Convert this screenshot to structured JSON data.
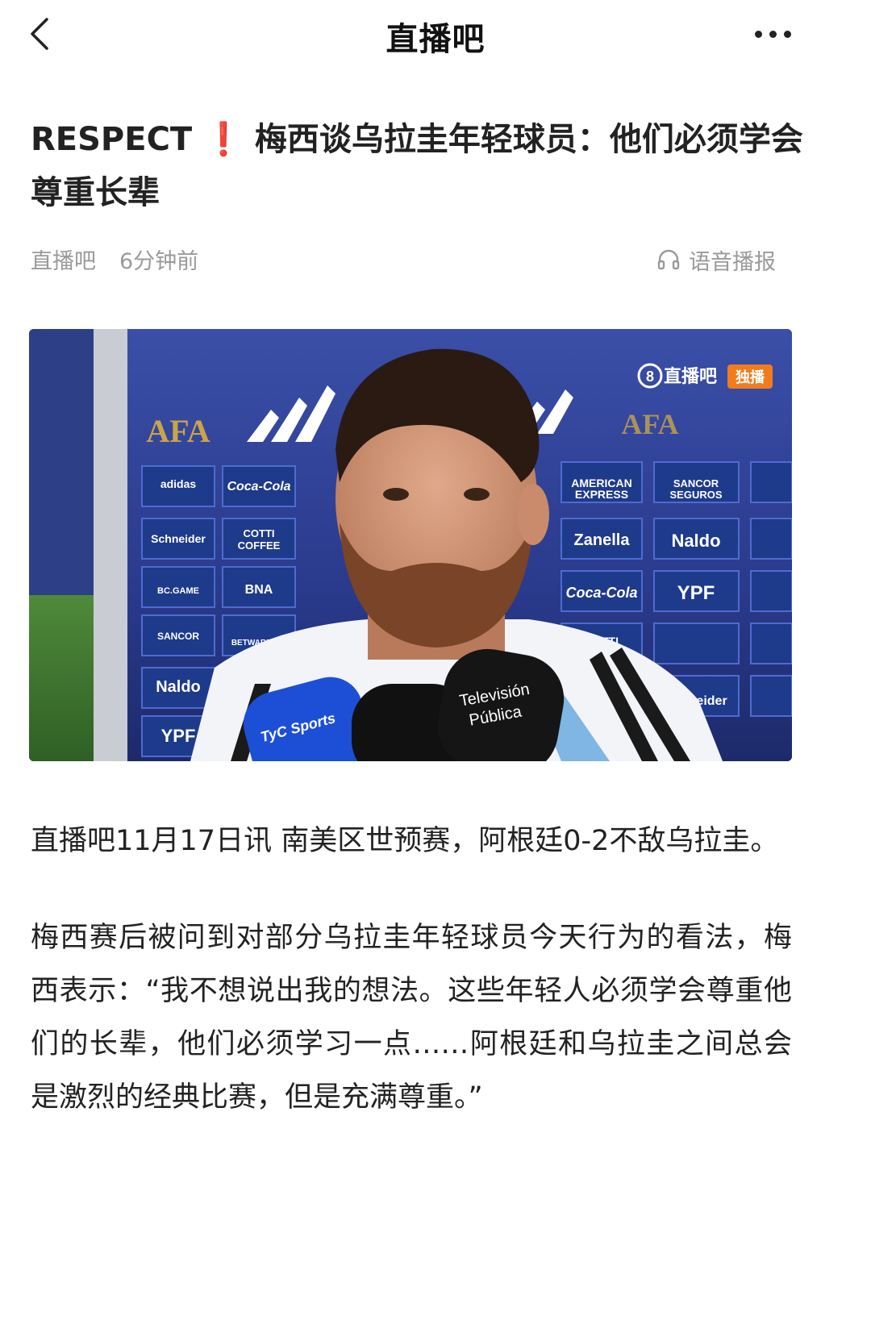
{
  "header": {
    "title": "直播吧"
  },
  "article": {
    "title_prefix": "RESPECT",
    "title_mark": "❗",
    "title_text": "梅西谈乌拉圭年轻球员：他们必须学会尊重长辈",
    "source": "直播吧",
    "time": "6分钟前",
    "tts_label": "语音播报",
    "image": {
      "watermark_brand": "直播吧",
      "watermark_tag": "独播",
      "mic_labels": [
        "Televisión Pública",
        "TyC Sports"
      ],
      "sponsor_boards": [
        "AMERICAN EXPRESS",
        "SANCOR SEGUROS",
        "Zanella",
        "Naldo",
        "YPF",
        "Coca-Cola",
        "COTTI COFFEE",
        "Schneider",
        "BNA",
        "BC.GAME",
        "BETWARRIOR"
      ]
    },
    "paragraphs": [
      "直播吧11月17日讯 南美区世预赛，阿根廷0-2不敌乌拉圭。",
      "梅西赛后被问到对部分乌拉圭年轻球员今天行为的看法，梅西表示：“我不想说出我的想法。这些年轻人必须学会尊重他们的长辈，他们必须学习一点……阿根廷和乌拉圭之间总会是激烈的经典比赛，但是充满尊重。”"
    ]
  },
  "icons": {
    "back": "chevron-left-icon",
    "more": "more-dots-icon",
    "tts": "headphones-icon"
  },
  "colors": {
    "accent_red": "#e8382f",
    "meta_gray": "#9a9a9a",
    "board_blue": "#1e3a8a"
  }
}
